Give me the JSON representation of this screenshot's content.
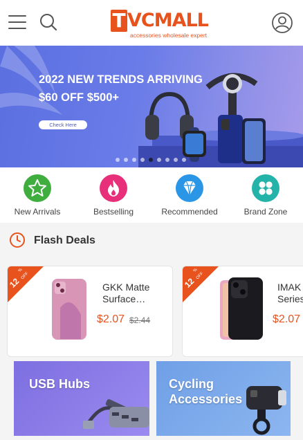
{
  "header": {
    "logo_mark": "T",
    "logo_text": "VCMALL",
    "logo_sub": "accessories wholesale expert"
  },
  "banner": {
    "title": "2022 NEW TRENDS ARRIVING",
    "offer": "$60 OFF $500+",
    "button": "Check Here",
    "slide_count": 9,
    "active_slide": 5
  },
  "categories": [
    {
      "label": "New Arrivals",
      "color": "#3fae3f",
      "icon": "star-icon"
    },
    {
      "label": "Bestselling",
      "color": "#e8307a",
      "icon": "flame-icon"
    },
    {
      "label": "Recommended",
      "color": "#2b96e6",
      "icon": "diamond-icon"
    },
    {
      "label": "Brand Zone",
      "color": "#24b3a8",
      "icon": "grid-icon"
    }
  ],
  "flash": {
    "title": "Flash Deals",
    "deals": [
      {
        "badge_pct": "12",
        "badge_off": "OFF",
        "badge_top": "%",
        "name_line1": "GKK Matte",
        "name_line2": "Surface…",
        "price": "$2.07",
        "old_price": "$2.44"
      },
      {
        "badge_pct": "12",
        "badge_off": "OFF",
        "badge_top": "%",
        "name_line1": "IMAK",
        "name_line2": "Series",
        "price": "$2.07",
        "old_price": ""
      }
    ]
  },
  "promos": [
    {
      "line1": "USB Hubs",
      "line2": ""
    },
    {
      "line1": "Cycling",
      "line2": "Accessories"
    }
  ],
  "colors": {
    "brand": "#e8521c",
    "price": "#e8521c",
    "banner_start": "#5b6fe0",
    "banner_end": "#a79bea"
  }
}
